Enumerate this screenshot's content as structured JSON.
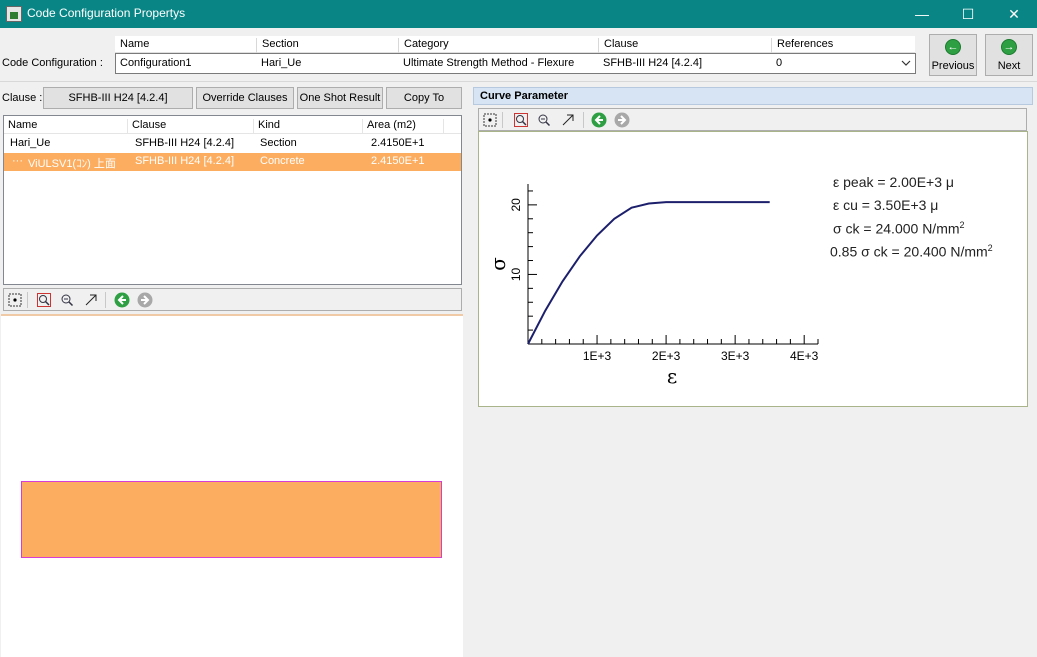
{
  "window": {
    "title": "Code Configuration Propertys",
    "minimize": "—",
    "maximize": "☐",
    "close": "✕"
  },
  "config": {
    "label": "Code Configuration :",
    "headers": [
      "Name",
      "Section",
      "Category",
      "Clause",
      "References"
    ],
    "values": {
      "name": "Configuration1",
      "section": "Hari_Ue",
      "category": "Ultimate Strength Method - Flexure",
      "clause": "SFHB-III H24 [4.2.4]",
      "references": "0"
    }
  },
  "nav": {
    "previous": "Previous",
    "next": "Next",
    "previous_icon": "←",
    "next_icon": "→"
  },
  "clause_bar": {
    "label": "Clause :",
    "clause_button": "SFHB-III H24 [4.2.4]",
    "override": "Override Clauses",
    "one_shot": "One Shot Result",
    "copy_to": "Copy To"
  },
  "table": {
    "headers": {
      "name": "Name",
      "clause": "Clause",
      "kind": "Kind",
      "area": "Area (m2)"
    },
    "rows": [
      {
        "name": "Hari_Ue",
        "clause": "SFHB-III H24 [4.2.4]",
        "kind": "Section",
        "area": "2.4150E+1"
      },
      {
        "name": "ViULSV1(ｺﾝ) 上面",
        "clause": "SFHB-III H24 [4.2.4]",
        "kind": "Concrete",
        "area": "2.4150E+1"
      }
    ]
  },
  "curve": {
    "title": "Curve Parameter",
    "params": {
      "eps_peak": "ε peak = 2.00E+3  μ",
      "eps_cu": "ε cu = 3.50E+3  μ",
      "sigma_ck": "σ ck = 24.000  N/mm",
      "sigma_ck85": "0.85 σ ck = 20.400  N/mm",
      "sup": "2"
    }
  },
  "chart_data": {
    "type": "line",
    "xlabel": "ε",
    "ylabel": "σ",
    "xlim": [
      0,
      4200
    ],
    "ylim": [
      0,
      23
    ],
    "xticks": [
      1000,
      2000,
      3000,
      4000
    ],
    "xtick_labels": [
      "1E+3",
      "2E+3",
      "3E+3",
      "4E+3"
    ],
    "yticks": [
      10,
      20
    ],
    "ytick_labels": [
      "10",
      "20"
    ],
    "series": [
      {
        "x": [
          0,
          250,
          500,
          750,
          1000,
          1250,
          1500,
          1750,
          2000,
          3500
        ],
        "y": [
          0,
          4.8,
          9.0,
          12.6,
          15.6,
          18.0,
          19.6,
          20.2,
          20.4,
          20.4
        ],
        "color": "#1c1f6b"
      }
    ]
  }
}
